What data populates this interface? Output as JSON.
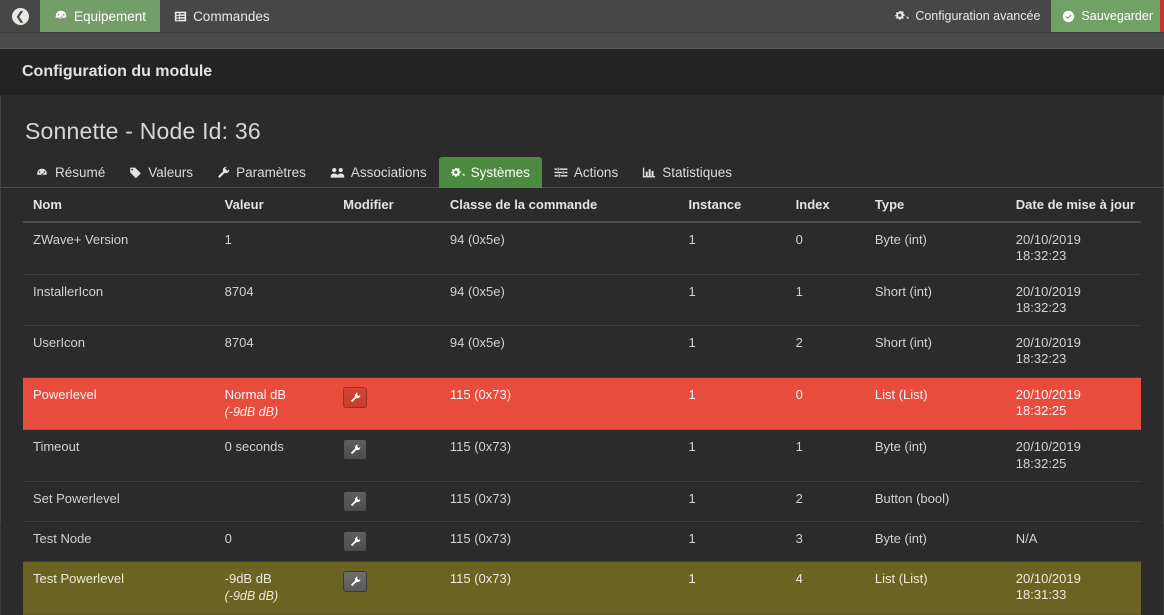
{
  "navbar": {
    "back_icon": "arrow-left-circle-icon",
    "tabs": [
      {
        "label": "Equipement",
        "icon": "dashboard-icon",
        "active": true
      },
      {
        "label": "Commandes",
        "icon": "list-icon",
        "active": false
      }
    ],
    "buttons": [
      {
        "label": "Configuration avancée",
        "icon": "gears-icon",
        "style": "plain"
      },
      {
        "label": "Sauvegarder",
        "icon": "check-circle-icon",
        "style": "green"
      }
    ]
  },
  "panel": {
    "heading": "Configuration du module",
    "module_title": "Sonnette - Node Id: 36"
  },
  "tabs": [
    {
      "label": "Résumé",
      "icon": "dashboard-icon",
      "active": false
    },
    {
      "label": "Valeurs",
      "icon": "tag-icon",
      "active": false
    },
    {
      "label": "Paramètres",
      "icon": "wrench-icon",
      "active": false
    },
    {
      "label": "Associations",
      "icon": "users-icon",
      "active": false
    },
    {
      "label": "Systèmes",
      "icon": "gears-icon",
      "active": true
    },
    {
      "label": "Actions",
      "icon": "sliders-icon",
      "active": false
    },
    {
      "label": "Statistiques",
      "icon": "bar-chart-icon",
      "active": false
    }
  ],
  "table": {
    "headers": [
      "Nom",
      "Valeur",
      "Modifier",
      "Classe de la commande",
      "Instance",
      "Index",
      "Type",
      "Date de mise à jour"
    ],
    "rows": [
      {
        "nom": "ZWave+ Version",
        "valeur": "1",
        "valeur_sub": "",
        "modifier": false,
        "classe": "94 (0x5e)",
        "instance": "1",
        "index": "0",
        "type": "Byte (int)",
        "date": "20/10/2019 18:32:23",
        "state": "normal"
      },
      {
        "nom": "InstallerIcon",
        "valeur": "8704",
        "valeur_sub": "",
        "modifier": false,
        "classe": "94 (0x5e)",
        "instance": "1",
        "index": "1",
        "type": "Short (int)",
        "date": "20/10/2019 18:32:23",
        "state": "normal"
      },
      {
        "nom": "UserIcon",
        "valeur": "8704",
        "valeur_sub": "",
        "modifier": false,
        "classe": "94 (0x5e)",
        "instance": "1",
        "index": "2",
        "type": "Short (int)",
        "date": "20/10/2019 18:32:23",
        "state": "normal"
      },
      {
        "nom": "Powerlevel",
        "valeur": "Normal dB",
        "valeur_sub": "(-9dB dB)",
        "modifier": true,
        "classe": "115 (0x73)",
        "instance": "1",
        "index": "0",
        "type": "List (List)",
        "date": "20/10/2019 18:32:25",
        "state": "danger"
      },
      {
        "nom": "Timeout",
        "valeur": "0 seconds",
        "valeur_sub": "",
        "modifier": true,
        "classe": "115 (0x73)",
        "instance": "1",
        "index": "1",
        "type": "Byte (int)",
        "date": "20/10/2019 18:32:25",
        "state": "normal"
      },
      {
        "nom": "Set Powerlevel",
        "valeur": "",
        "valeur_sub": "",
        "modifier": true,
        "classe": "115 (0x73)",
        "instance": "1",
        "index": "2",
        "type": "Button (bool)",
        "date": "",
        "state": "normal"
      },
      {
        "nom": "Test Node",
        "valeur": "0",
        "valeur_sub": "",
        "modifier": true,
        "classe": "115 (0x73)",
        "instance": "1",
        "index": "3",
        "type": "Byte (int)",
        "date": "N/A",
        "state": "normal"
      },
      {
        "nom": "Test Powerlevel",
        "valeur": "-9dB dB",
        "valeur_sub": "(-9dB dB)",
        "modifier": true,
        "classe": "115 (0x73)",
        "instance": "1",
        "index": "4",
        "type": "List (List)",
        "date": "20/10/2019 18:31:33",
        "state": "warning"
      }
    ]
  },
  "colors": {
    "accent_green": "#4c8a3f",
    "navbar_green": "#739e68",
    "danger_red": "#e74c3c",
    "warning_olive": "#6b6322",
    "panel_bg": "#2b2b2b",
    "heading_bg": "#232323"
  }
}
